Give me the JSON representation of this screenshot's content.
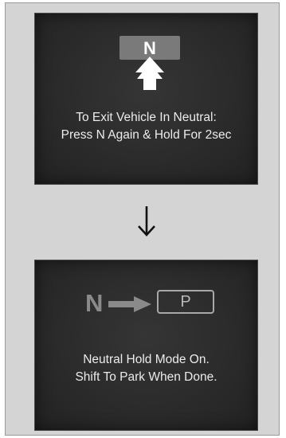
{
  "top_screen": {
    "gear_label": "N",
    "message_line1": "To Exit Vehicle In Neutral:",
    "message_line2": "Press N Again & Hold For 2sec"
  },
  "bottom_screen": {
    "from_gear": "N",
    "to_gear": "P",
    "message_line1": "Neutral Hold Mode On.",
    "message_line2": "Shift To Park When Done."
  },
  "icons": {
    "up_arrow": "up-arrow-icon",
    "down_arrow": "down-arrow-icon",
    "right_arrow": "right-arrow-icon"
  },
  "colors": {
    "screen_bg": "#2b2b2b",
    "frame_bg": "#d4d4d4",
    "text": "#ececec",
    "n_box": "#7a7a7a"
  }
}
